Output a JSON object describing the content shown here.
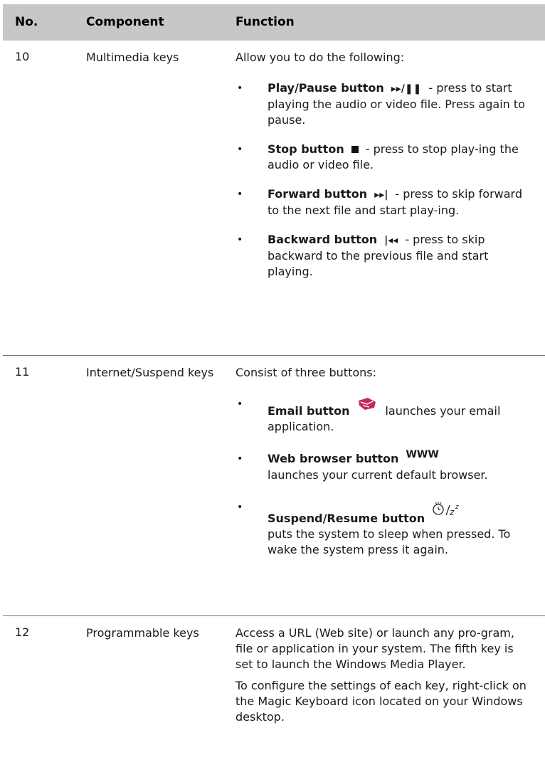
{
  "headers": {
    "no": "No.",
    "component": "Component",
    "function": "Function"
  },
  "rows": [
    {
      "no": "10",
      "component": "Multimedia keys",
      "intro": "Allow you to do the following:",
      "items": [
        {
          "name": "Play/Pause button",
          "icon": "play-pause-icon",
          "text": "- press to start playing the audio or video file. Press again to pause."
        },
        {
          "name": "Stop button",
          "icon": "stop-icon",
          "text": "- press to stop play-ing the audio or video file."
        },
        {
          "name": "Forward button",
          "icon": "skip-forward-icon",
          "text": "- press to skip forward to the next file and start play-ing."
        },
        {
          "name": "Backward button",
          "icon": "skip-backward-icon",
          "text": "- press to skip backward to the previous file and start playing."
        }
      ]
    },
    {
      "no": "11",
      "component": "Internet/Suspend keys",
      "intro": "Consist of three buttons:",
      "items": [
        {
          "name": "Email button",
          "icon": "email-icon",
          "text": "launches your email application."
        },
        {
          "name": "Web browser button",
          "icon": "www-icon",
          "icon_text": "WWW",
          "text": "launches your current default browser."
        },
        {
          "name": "Suspend/Resume button",
          "icon": "suspend-resume-icon",
          "text": "puts the system to sleep when pressed. To wake the system press it again."
        }
      ]
    },
    {
      "no": "12",
      "component": "Programmable keys",
      "paragraphs": [
        "Access a URL (Web site) or launch any pro-gram, file or application in your system. The fifth key is set to launch the Windows Media Player.",
        "To configure the settings of each key, right-click on the Magic Keyboard icon located on your Windows desktop."
      ]
    }
  ]
}
